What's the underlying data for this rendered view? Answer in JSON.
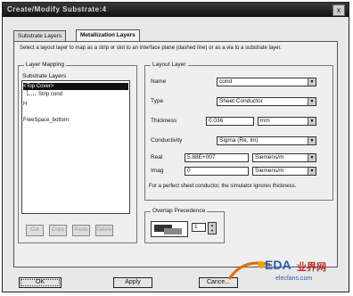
{
  "window": {
    "title": "Create/Modify Substrate:4",
    "close_label": "x"
  },
  "tabs": [
    {
      "label": "Substrate Layers"
    },
    {
      "label": "Metallization Layers"
    }
  ],
  "description": "Select a layout layer to map as a strip or slot to an interface plane (dashed line) or as a via to a substrate layer.",
  "layer_mapping": {
    "group_label": "Layer Mapping",
    "list_header": "Substrate Layers",
    "items": [
      {
        "label": "<Top Cover>"
      },
      {
        "label": "Strip cond"
      },
      {
        "label": "H"
      },
      {
        "label": "FreeSpace_bottom"
      }
    ],
    "buttons": [
      "Cut",
      "Copy",
      "Paste",
      "Delete"
    ]
  },
  "layout_layer": {
    "group_label": "Layout Layer",
    "name_label": "Name",
    "name_value": "cond",
    "type_label": "Type",
    "type_value": "Sheet Conductor",
    "thickness_label": "Thickness",
    "thickness_value": "0.036",
    "thickness_unit": "mm",
    "conductivity_label": "Conductivity",
    "conductivity_value": "Sigma (Re, Im)",
    "real_label": "Real",
    "real_value": "5.88E+007",
    "real_unit": "Siemens/m",
    "imag_label": "Imag",
    "imag_value": "0",
    "imag_unit": "Siemens/m",
    "note": "For a perfect sheet conductor, the simulator ignores thickness."
  },
  "overlap": {
    "group_label": "Overlap Precedence",
    "value": "1"
  },
  "footer": {
    "ok": "OK",
    "apply": "Apply",
    "cancel": "Cance..."
  },
  "watermark": {
    "text": "EDA",
    "site": "elecfans.com",
    "subtitle": "业界网"
  },
  "colors": {
    "titlebar": "#1a1a1a",
    "panel": "#efefef",
    "selection": "#111111"
  }
}
